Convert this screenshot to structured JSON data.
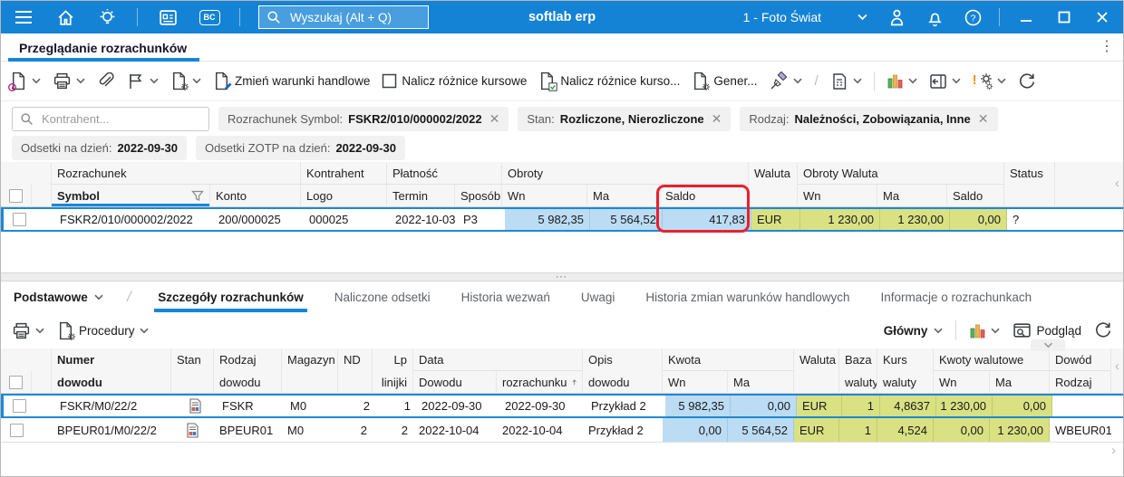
{
  "icons": {
    "more_options": "⋮",
    "drag_handle": "⋯",
    "collapse_left": "‹",
    "scroll_right": "›",
    "separator_slash": "/"
  },
  "topbar": {
    "app_name": "softlab erp",
    "company_selector": "1 - Foto Świat",
    "search_placeholder": "Wyszukaj (Alt + Q)",
    "bc_badge": "BC"
  },
  "main_tab": {
    "title": "Przeglądanie rozrachunków"
  },
  "toolbar": {
    "zmien_warunki": "Zmień warunki handlowe",
    "nalicz_roznice_1": "Nalicz różnice kursowe",
    "nalicz_roznice_2": "Nalicz różnice kurso...",
    "generuj": "Gener..."
  },
  "filters": {
    "kontrahent_placeholder": "Kontrahent...",
    "chips": [
      {
        "label": "Rozrachunek  Symbol:",
        "value": "FSKR2/010/000002/2022"
      },
      {
        "label": "Stan:",
        "value": "Rozliczone, Nierozliczone"
      },
      {
        "label": "Rodzaj:",
        "value": "Należności, Zobowiązania, Inne"
      },
      {
        "label": "Odsetki  na dzień:",
        "value": "2022-09-30"
      },
      {
        "label": "Odsetki ZOTP  na dzień:",
        "value": "2022-09-30"
      }
    ]
  },
  "upper_grid": {
    "groups": {
      "rozrachunek": "Rozrachunek",
      "kontrahent": "Kontrahent",
      "platnosc": "Płatność",
      "obroty": "Obroty",
      "waluta": "Waluta",
      "obroty_waluta": "Obroty Waluta",
      "status": "Status"
    },
    "cols": {
      "symbol": "Symbol",
      "konto": "Konto",
      "logo": "Logo",
      "termin": "Termin",
      "sposob": "Sposób",
      "wn": "Wn",
      "ma": "Ma",
      "saldo": "Saldo",
      "ow_wn": "Wn",
      "ow_ma": "Ma",
      "ow_saldo": "Saldo"
    },
    "row": {
      "symbol": "FSKR2/010/000002/2022",
      "konto": "200/000025",
      "logo": "000025",
      "termin": "2022-10-03",
      "sposob": "P3",
      "wn": "5 982,35",
      "ma": "5 564,52",
      "saldo": "417,83",
      "waluta": "EUR",
      "ow_wn": "1 230,00",
      "ow_ma": "1 230,00",
      "ow_saldo": "0,00",
      "status": "?"
    }
  },
  "detail_tabs": {
    "selector": "Podstawowe",
    "tab_szczegoly": "Szczegóły rozrachunków",
    "tab_odsetki": "Naliczone odsetki",
    "tab_wezwania": "Historia wezwań",
    "tab_uwagi": "Uwagi",
    "tab_historia_zmian": "Historia zmian warunków handlowych",
    "tab_informacje": "Informacje o rozrachunkach"
  },
  "detail_toolbar": {
    "procedury": "Procedury",
    "layout": "Główny",
    "podglad": "Podgląd"
  },
  "lower_grid": {
    "groups": {
      "data": "Data",
      "kwota": "Kwota",
      "kwoty_walutowe": "Kwoty walutowe",
      "dowod": "Dowód"
    },
    "cols": {
      "numer_1": "Numer",
      "numer_2": "dowodu",
      "stan": "Stan",
      "rodzaj_1": "Rodzaj",
      "rodzaj_2": "dowodu",
      "magazyn": "Magazyn",
      "nd": "ND",
      "lp_1": "Lp",
      "lp_2": "linijki",
      "data_dowodu": "Dowodu",
      "data_rozrachunku": "rozrachunku",
      "opis_1": "Opis",
      "opis_2": "dowodu",
      "kwota_wn": "Wn",
      "kwota_ma": "Ma",
      "waluta": "Waluta",
      "baza_1": "Baza",
      "baza_2": "waluty",
      "kurs_1": "Kurs",
      "kurs_2": "waluty",
      "kw_wn": "Wn",
      "kw_ma": "Ma",
      "dowod_rodzaj": "Rodzaj"
    },
    "rows": [
      {
        "numer": "FSKR/M0/22/2",
        "rodzaj": "FSKR",
        "magazyn": "M0",
        "nd": "2",
        "lp": "1",
        "data_dowodu": "2022-09-30",
        "data_rozrachunku": "2022-09-30",
        "opis": "Przykład 2",
        "wn": "5 982,35",
        "ma": "0,00",
        "waluta": "EUR",
        "baza": "1",
        "kurs": "4,8637",
        "kw_wn": "1 230,00",
        "kw_ma": "0,00",
        "dowod_rodzaj": ""
      },
      {
        "numer": "BPEUR01/M0/22/2",
        "rodzaj": "BPEUR01",
        "magazyn": "M0",
        "nd": "2",
        "lp": "2",
        "data_dowodu": "2022-10-04",
        "data_rozrachunku": "2022-10-04",
        "opis": "Przykład 2",
        "wn": "0,00",
        "ma": "5 564,52",
        "waluta": "EUR",
        "baza": "1",
        "kurs": "4,524",
        "kw_wn": "0,00",
        "kw_ma": "1 230,00",
        "dowod_rodzaj": "WBEUR01"
      }
    ]
  },
  "colors": {
    "topbar_blue": "#1583d5",
    "accent_blue": "#1686d8",
    "cell_blue": "#bcdcf4",
    "cell_yellow": "#d9e183",
    "highlight_red": "#e8212e"
  }
}
